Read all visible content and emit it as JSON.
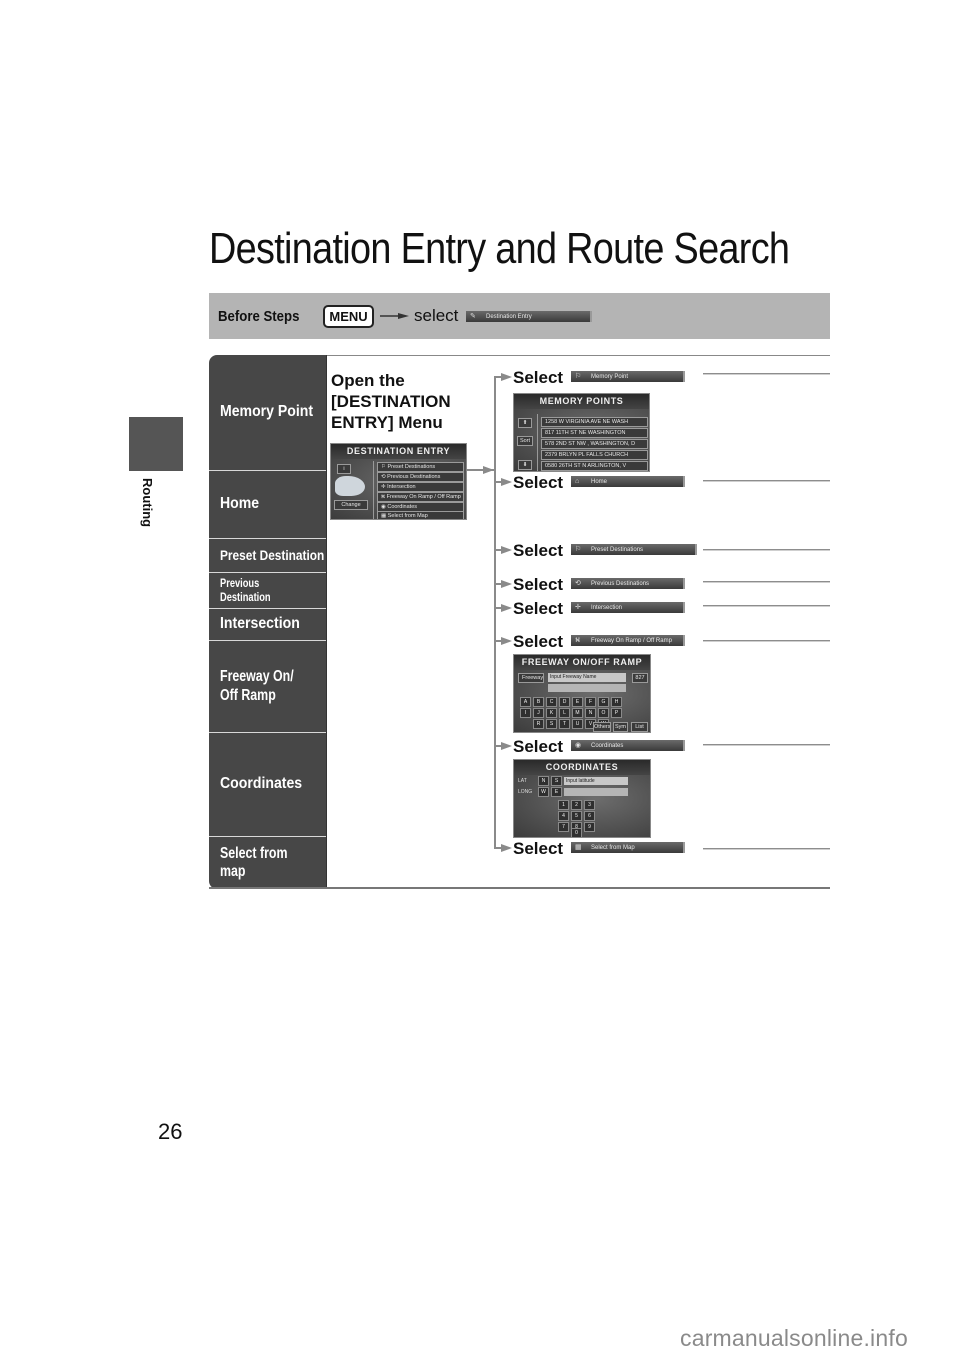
{
  "side_tab": {
    "label": "Routing"
  },
  "page_number": "26",
  "watermark": "carmanualsonline.info",
  "title": "Destination Entry and Route Search",
  "before_steps": {
    "label": "Before Steps",
    "menu_key": "MENU",
    "select_word": "select",
    "button": {
      "icon": "✎",
      "label": "Destination Entry"
    }
  },
  "categories": [
    {
      "label": "Memory Point"
    },
    {
      "label": "Home"
    },
    {
      "label": "Preset Destination"
    },
    {
      "label_line1": "Previous",
      "label_line2": "Destination"
    },
    {
      "label": "Intersection"
    },
    {
      "label_line1": "Freeway On/",
      "label_line2": "Off Ramp"
    },
    {
      "label": "Coordinates"
    },
    {
      "label_line1": "Select from",
      "label_line2": "map"
    }
  ],
  "open_menu": {
    "line1": "Open the",
    "line2": "[DESTINATION",
    "line3": "ENTRY] Menu"
  },
  "destination_entry_screen": {
    "title": "DESTINATION ENTRY",
    "info_button": "i",
    "change_button": "Change",
    "items": [
      {
        "icon": "⚐",
        "label": "Preset Destinations"
      },
      {
        "icon": "⟲",
        "label": "Previous Destinations"
      },
      {
        "icon": "✛",
        "label": "Intersection"
      },
      {
        "icon": "⛕",
        "label": "Freeway On Ramp / Off Ramp"
      },
      {
        "icon": "◉",
        "label": "Coordinates"
      },
      {
        "icon": "▦",
        "label": "Select from Map"
      }
    ]
  },
  "select_word": "Select",
  "steps": [
    {
      "icon": "⚐",
      "button_label": "Memory Point"
    },
    {
      "icon": "⌂",
      "button_label": "Home"
    },
    {
      "icon": "⚐",
      "button_label": "Preset Destinations"
    },
    {
      "icon": "⟲",
      "button_label": "Previous Destinations"
    },
    {
      "icon": "✛",
      "button_label": "Intersection"
    },
    {
      "icon": "⛕",
      "button_label": "Freeway On Ramp / Off Ramp"
    },
    {
      "icon": "◉",
      "button_label": "Coordinates"
    },
    {
      "icon": "▦",
      "button_label": "Select from Map"
    }
  ],
  "memory_points_screen": {
    "title": "MEMORY POINTS",
    "up": "⬆",
    "sort": "Sort",
    "down": "⬇",
    "entries": [
      "1258 W VIRGINIA AVE NE  WASH",
      "817 11TH ST NE  WASHINGTON",
      "578 2ND ST NW , WASHINGTON, D",
      "2379 BRLYN PL  FALLS CHURCH",
      "0580 26TH ST N  ARLINGTON, V"
    ]
  },
  "freeway_screen": {
    "title": "FREEWAY ON/OFF RAMP",
    "field_label": "Freeway",
    "input_placeholder": "Input Freeway Name",
    "count": "827",
    "keys_row1": [
      "A",
      "B",
      "C",
      "D",
      "E",
      "F",
      "G",
      "H"
    ],
    "keys_row2": [
      "I",
      "J",
      "K",
      "L",
      "M",
      "N",
      "O",
      "P"
    ],
    "keys_row3": [
      "R",
      "S",
      "T",
      "U",
      "V",
      "W"
    ],
    "others": "Others",
    "sym": "Sym",
    "list": "List"
  },
  "coordinates_screen": {
    "title": "COORDINATES",
    "lat_label": "LAT",
    "lon_label": "LONG",
    "n": "N",
    "s": "S",
    "w": "W",
    "e": "E",
    "input_placeholder": "Input latitude",
    "keys": [
      "1",
      "2",
      "3",
      "4",
      "5",
      "6",
      "7",
      "8",
      "9",
      "0"
    ]
  }
}
